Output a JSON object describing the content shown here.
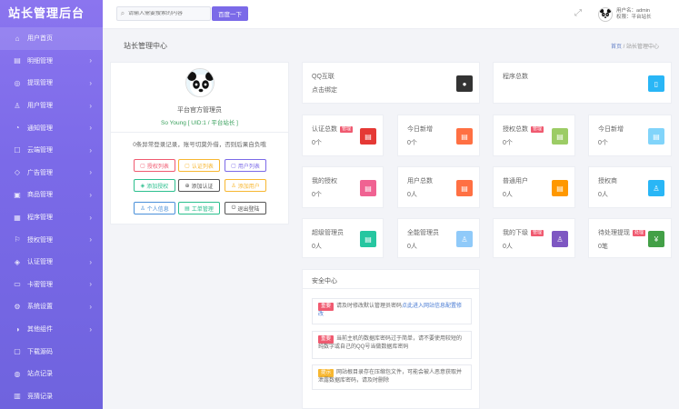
{
  "brand": "站长管理后台",
  "sidebar": {
    "items": [
      {
        "label": "用户首页",
        "icon": "home-icon",
        "glyph": "⌂",
        "chevron": false
      },
      {
        "label": "明细管理",
        "icon": "list-icon",
        "glyph": "▤",
        "chevron": true
      },
      {
        "label": "提现管理",
        "icon": "wallet-icon",
        "glyph": "◎",
        "chevron": true
      },
      {
        "label": "用户管理",
        "icon": "user-icon",
        "glyph": "♙",
        "chevron": true
      },
      {
        "label": "通知管理",
        "icon": "bell-icon",
        "glyph": "◔",
        "chevron": true
      },
      {
        "label": "云端管理",
        "icon": "cloud-icon",
        "glyph": "☐",
        "chevron": true
      },
      {
        "label": "广告管理",
        "icon": "ad-icon",
        "glyph": "◇",
        "chevron": true
      },
      {
        "label": "商品管理",
        "icon": "goods-icon",
        "glyph": "▣",
        "chevron": true
      },
      {
        "label": "程序管理",
        "icon": "program-icon",
        "glyph": "▦",
        "chevron": true
      },
      {
        "label": "授权管理",
        "icon": "flag-icon",
        "glyph": "⚐",
        "chevron": true
      },
      {
        "label": "认证管理",
        "icon": "shield-icon",
        "glyph": "◈",
        "chevron": true
      },
      {
        "label": "卡密管理",
        "icon": "card-icon",
        "glyph": "▭",
        "chevron": true
      },
      {
        "label": "系统设置",
        "icon": "gear-icon",
        "glyph": "⚙",
        "chevron": true
      },
      {
        "label": "其他组件",
        "icon": "component-icon",
        "glyph": "◑",
        "chevron": true
      },
      {
        "label": "下载源码",
        "icon": "download-icon",
        "glyph": "▢",
        "chevron": false
      },
      {
        "label": "站点记录",
        "icon": "globe-icon",
        "glyph": "◍",
        "chevron": false
      },
      {
        "label": "竞猜记录",
        "icon": "record-icon",
        "glyph": "▥",
        "chevron": false
      }
    ]
  },
  "topbar": {
    "search_placeholder": "请输入需要搜索的内容",
    "search_button": "百度一下",
    "user_line1": "用户名：admin",
    "user_line2": "权限：平台站长"
  },
  "page": {
    "title": "站长管理中心",
    "crumb_home": "首页",
    "crumb_sep": "/",
    "crumb_current": "站长管理中心"
  },
  "profile": {
    "name": "平台官方管理员",
    "uid": "So Young [ UID:1 / 平台站长 ]",
    "note": "0条异常登录记录，账号切莫外借，否则后果自负哦",
    "buttons": [
      {
        "label": "授权列表",
        "glyph": "▢",
        "color": "#f05a70"
      },
      {
        "label": "认证列表",
        "glyph": "▢",
        "color": "#f7b731"
      },
      {
        "label": "用户列表",
        "glyph": "▢",
        "color": "#7b6ae8"
      },
      {
        "label": "添加授权",
        "glyph": "◈",
        "color": "#2bbf8e"
      },
      {
        "label": "添加认证",
        "glyph": "⊕",
        "color": "#555555"
      },
      {
        "label": "添加用户",
        "glyph": "♙",
        "color": "#f7b731"
      },
      {
        "label": "个人信息",
        "glyph": "♙",
        "color": "#4a90d9"
      },
      {
        "label": "工单管理",
        "glyph": "▤",
        "color": "#2bbf8e"
      },
      {
        "label": "退出登陆",
        "glyph": "⏻",
        "color": "#555555"
      }
    ]
  },
  "cards": [
    {
      "label": "QQ互联",
      "value": "点击绑定",
      "tag": "",
      "color": "#333333",
      "icon": "qq-icon",
      "glyph": "●"
    },
    {
      "label": "程序总数",
      "value": "",
      "tag": "",
      "color": "#29b6f6",
      "icon": "mobile-icon",
      "glyph": "▯"
    },
    {
      "label": "认证总数",
      "value": "0个",
      "tag": "管理",
      "color": "#e53935",
      "icon": "doc-icon",
      "glyph": "▤"
    },
    {
      "label": "今日新增",
      "value": "0个",
      "tag": "",
      "color": "#ff7043",
      "icon": "doc-icon",
      "glyph": "▤"
    },
    {
      "label": "授权总数",
      "value": "0个",
      "tag": "管理",
      "color": "#9ccc65",
      "icon": "doc-icon",
      "glyph": "▤"
    },
    {
      "label": "今日新增",
      "value": "0个",
      "tag": "",
      "color": "#81d4fa",
      "icon": "doc-icon",
      "glyph": "▤"
    },
    {
      "label": "我的授权",
      "value": "0个",
      "tag": "",
      "color": "#f06292",
      "icon": "doc-icon",
      "glyph": "▤"
    },
    {
      "label": "用户总数",
      "value": "0人",
      "tag": "",
      "color": "#ff7043",
      "icon": "doc-icon",
      "glyph": "▤"
    },
    {
      "label": "普通用户",
      "value": "0人",
      "tag": "",
      "color": "#ff9800",
      "icon": "doc-icon",
      "glyph": "▤"
    },
    {
      "label": "授权商",
      "value": "0人",
      "tag": "",
      "color": "#29b6f6",
      "icon": "user-icon",
      "glyph": "♙"
    },
    {
      "label": "超级管理员",
      "value": "0人",
      "tag": "",
      "color": "#26c6a0",
      "icon": "doc-icon",
      "glyph": "▤"
    },
    {
      "label": "全能管理员",
      "value": "0人",
      "tag": "",
      "color": "#90caf9",
      "icon": "user-icon",
      "glyph": "♙"
    },
    {
      "label": "我的下级",
      "value": "0人",
      "tag": "管理",
      "color": "#7e57c2",
      "icon": "user-icon",
      "glyph": "♙"
    },
    {
      "label": "待处理提现",
      "value": "0笔",
      "tag": "处理",
      "color": "#43a047",
      "icon": "money-icon",
      "glyph": "¥"
    }
  ],
  "security": {
    "title": "安全中心",
    "alerts": [
      {
        "badge": "重要",
        "badge_color": "#f05a70",
        "text": "请及时修改默认管理员密码",
        "link": "点此进入网站信息配置修改"
      },
      {
        "badge": "重要",
        "badge_color": "#f05a70",
        "text": "当前主机的数据库密码过于简单，请不要使用较短的纯数字或自己的QQ号当做数据库密码",
        "link": ""
      },
      {
        "badge": "提示",
        "badge_color": "#f7b731",
        "text": "网站根目录存在压缩包文件，可能会被人恶意获取并泄露数据库密码，请及时删除",
        "link": ""
      }
    ]
  }
}
